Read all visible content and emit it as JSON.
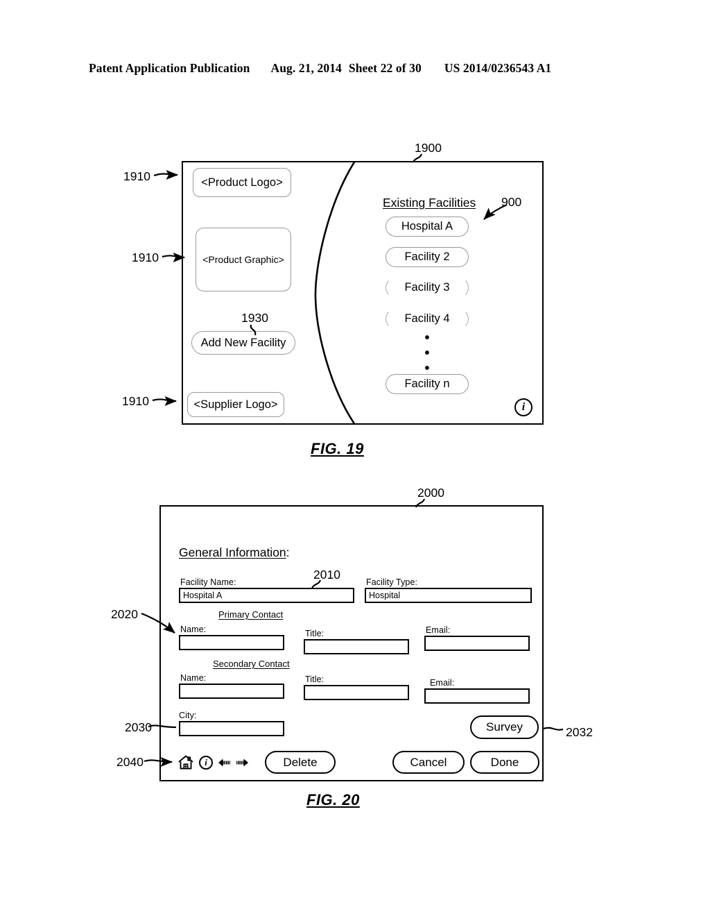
{
  "header": {
    "publication": "Patent Application Publication",
    "date": "Aug. 21, 2014",
    "sheet": "Sheet 22 of 30",
    "patent_number": "US 2014/0236543 A1"
  },
  "fig19": {
    "caption": "FIG. 19",
    "panel_ref": "1900",
    "left_panel": {
      "product_logo": "<Product Logo>",
      "product_graphic": "<Product Graphic>",
      "add_new_facility": "Add New Facility",
      "supplier_logo": "<Supplier Logo>",
      "ref_logo": "1910",
      "ref_graphic": "1910",
      "ref_supplier": "1910",
      "ref_add_new": "1930"
    },
    "right_panel": {
      "title": "Existing Facilities",
      "ref_list": "900",
      "facilities": [
        {
          "label": "Hospital A",
          "style": "full"
        },
        {
          "label": "Facility 2",
          "style": "full"
        },
        {
          "label": "Facility 3",
          "style": "partial"
        },
        {
          "label": "Facility 4",
          "style": "partial"
        },
        {
          "label": "Facility n",
          "style": "full"
        }
      ],
      "ellipsis": [
        "•",
        "•",
        "•"
      ],
      "info_icon_label": "i"
    }
  },
  "fig20": {
    "caption": "FIG. 20",
    "panel_ref": "2000",
    "general_information_label": "General Information",
    "general_information_colon": ":",
    "ref_facility_name": "2010",
    "ref_primary_contact": "2020",
    "ref_city": "2030",
    "ref_survey": "2032",
    "ref_toolbar": "2040",
    "fields": {
      "facility_name": {
        "label": "Facility Name:",
        "value": "Hospital A"
      },
      "facility_type": {
        "label": "Facility Type:",
        "value": "Hospital"
      },
      "primary_contact_section": "Primary Contact",
      "primary_name": {
        "label": "Name:",
        "value": ""
      },
      "primary_title": {
        "label": "Title:",
        "value": ""
      },
      "primary_email": {
        "label": "Email:",
        "value": ""
      },
      "secondary_contact_section": "Secondary Contact",
      "secondary_name": {
        "label": "Name:",
        "value": ""
      },
      "secondary_title": {
        "label": "Title:",
        "value": ""
      },
      "secondary_email": {
        "label": "Email:",
        "value": ""
      },
      "city": {
        "label": "City:",
        "value": ""
      }
    },
    "buttons": {
      "survey": "Survey",
      "delete": "Delete",
      "cancel": "Cancel",
      "done": "Done"
    },
    "toolbar": {
      "home_icon": "home-icon",
      "info_icon": "info-icon",
      "info_icon_label": "i",
      "back_icon": "back-arrow-icon",
      "forward_icon": "forward-arrow-icon"
    }
  }
}
